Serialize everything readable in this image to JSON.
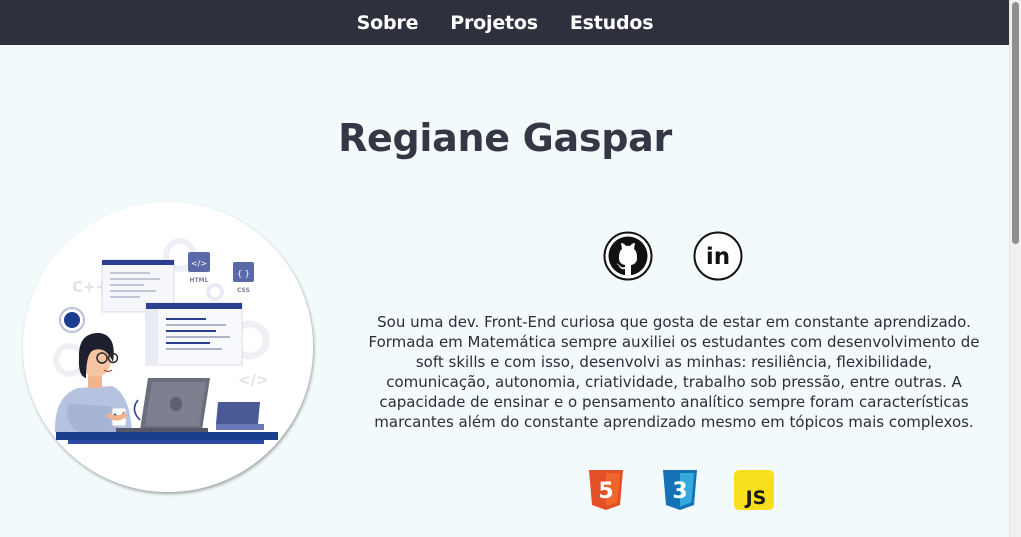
{
  "nav": {
    "items": [
      {
        "label": "Sobre"
      },
      {
        "label": "Projetos"
      },
      {
        "label": "Estudos"
      }
    ]
  },
  "header": {
    "title": "Regiane Gaspar"
  },
  "illustration": {
    "labels": {
      "html": "HTML",
      "css": "CSS",
      "html_tag": "</>",
      "css_tag": "{ }",
      "cpp": "C++",
      "code_tag": "</>"
    }
  },
  "social": {
    "icons": [
      "github-icon",
      "linkedin-icon"
    ],
    "linkedin_text": "in"
  },
  "bio": {
    "text": "Sou uma dev. Front-End curiosa que gosta de estar em constante aprendizado. Formada em Matemática sempre auxiliei os estudantes com desenvolvimento de soft skills e com isso, desenvolvi as minhas: resiliência, flexibilidade, comunicação, autonomia, criatividade, trabalho sob pressão, entre outras. A capacidade de ensinar e o pensamento analítico sempre foram características marcantes além do constante aprendizado mesmo em tópicos mais complexos."
  },
  "tech": {
    "html_number": "5",
    "css_number": "3",
    "js_label": "JS"
  },
  "colors": {
    "navbar": "#2e303d",
    "background": "#f2fafb",
    "title": "#343845",
    "html5": "#e34f26",
    "css3": "#1572b6",
    "js": "#f7df1e"
  }
}
